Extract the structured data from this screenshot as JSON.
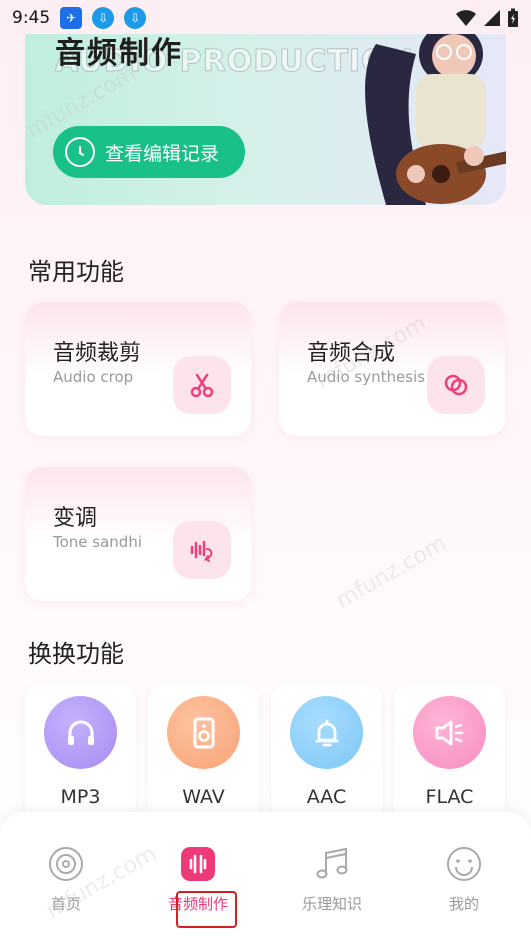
{
  "status_bar": {
    "time": "9:45"
  },
  "banner": {
    "title": "音频制作",
    "subtitle": "AUDIO PRODUCTION",
    "history_button_label": "查看编辑记录"
  },
  "common_functions": {
    "title": "常用功能",
    "items": [
      {
        "name": "音频裁剪",
        "en": "Audio crop",
        "icon": "scissors-icon"
      },
      {
        "name": "音频合成",
        "en": "Audio synthesis",
        "icon": "merge-circles-icon"
      },
      {
        "name": "变调",
        "en": "Tone sandhi",
        "icon": "voice-wave-icon"
      }
    ]
  },
  "convert_functions": {
    "title": "换换功能",
    "items": [
      {
        "label": "MP3",
        "icon": "headphones-icon",
        "color": "#a98cf0"
      },
      {
        "label": "WAV",
        "icon": "speaker-icon",
        "color": "#f7a377"
      },
      {
        "label": "AAC",
        "icon": "bell-icon",
        "color": "#7cc8f5"
      },
      {
        "label": "FLAC",
        "icon": "volume-icon",
        "color": "#f78cc0"
      }
    ]
  },
  "bottom_nav": {
    "items": [
      {
        "label": "首页",
        "icon": "disc-icon",
        "active": false
      },
      {
        "label": "音频制作",
        "icon": "audio-bars-icon",
        "active": true
      },
      {
        "label": "乐理知识",
        "icon": "music-note-icon",
        "active": false
      },
      {
        "label": "我的",
        "icon": "smiley-icon",
        "active": false
      }
    ]
  },
  "watermark": "mfunz.com",
  "colors": {
    "accent": "#ef3a7a",
    "green": "#19c087",
    "highlight": "#d42020"
  }
}
